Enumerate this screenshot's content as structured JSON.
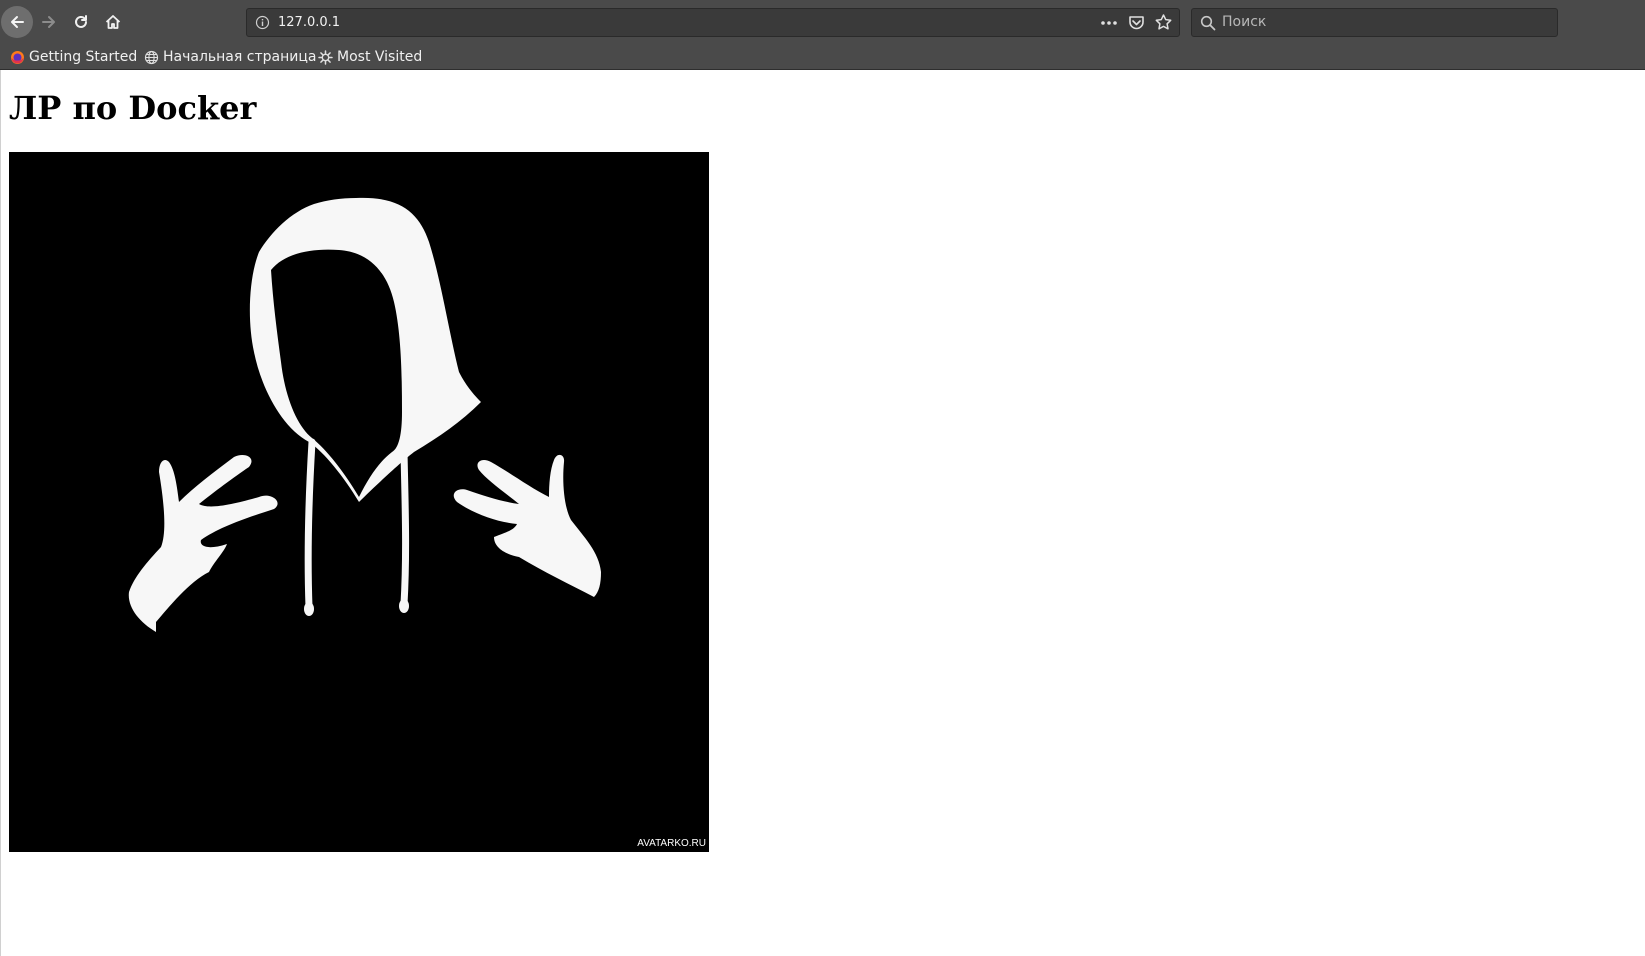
{
  "browser": {
    "url": "127.0.0.1",
    "search_placeholder": "Поиск",
    "icons": {
      "back": "arrow-left-icon",
      "forward": "arrow-right-icon",
      "reload": "reload-icon",
      "home": "home-icon",
      "info": "info-icon",
      "page_actions": "more-horizontal-icon",
      "pocket": "pocket-icon",
      "bookmark": "star-icon",
      "search": "search-icon"
    },
    "colors": {
      "toolbar": "#4a4a4a",
      "field": "#3a3a3a"
    }
  },
  "bookmarks": [
    {
      "label": "Getting Started",
      "icon": "firefox-icon"
    },
    {
      "label": "Начальная страница",
      "icon": "globe-icon"
    },
    {
      "label": "Most Visited",
      "icon": "gear-icon"
    }
  ],
  "page": {
    "title": "ЛР по Docker",
    "image": {
      "description_icon": "hooded-figure-image",
      "watermark": "AVATARKO.RU"
    }
  }
}
